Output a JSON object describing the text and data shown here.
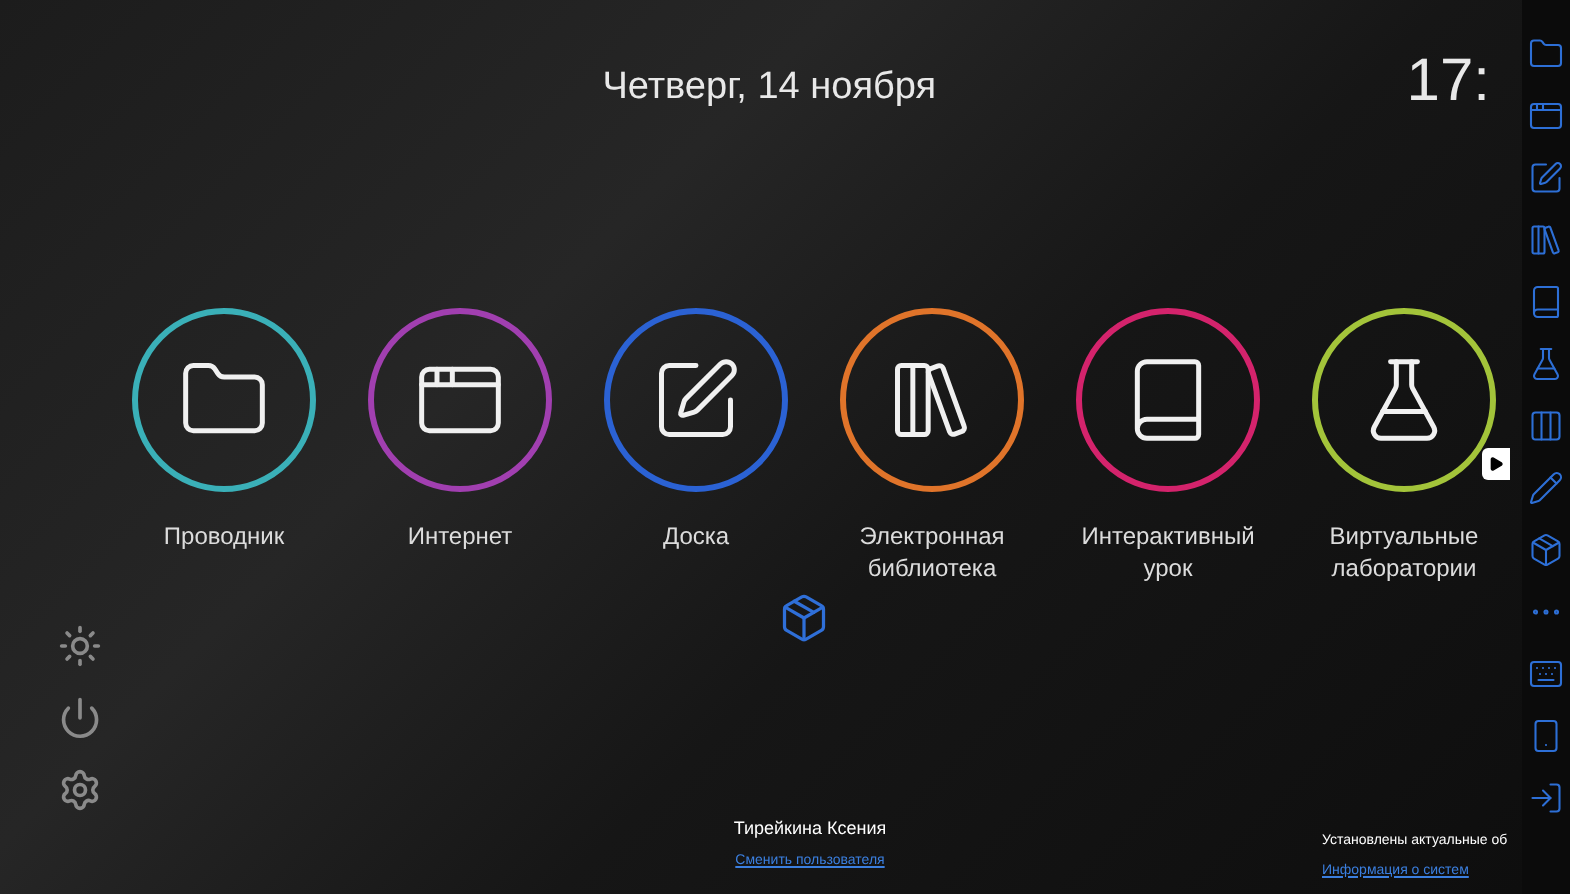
{
  "date": "Четверг, 14 ноября",
  "clock": "17:",
  "apps": [
    {
      "label": "Проводник",
      "color": "#3ab0b8"
    },
    {
      "label": "Интернет",
      "color": "#a13fb0"
    },
    {
      "label": "Доска",
      "color": "#2b62d4"
    },
    {
      "label": "Электронная библиотека",
      "color": "#e0742a"
    },
    {
      "label": "Интерактивный урок",
      "color": "#d4236c"
    },
    {
      "label": "Виртуальные лаборатории",
      "color": "#a3c43a"
    }
  ],
  "user": {
    "name": "Тирейкина Ксения",
    "link": "Сменить пользователя"
  },
  "update": {
    "text": "Установлены актуальные об",
    "link": "Информация о систем"
  }
}
